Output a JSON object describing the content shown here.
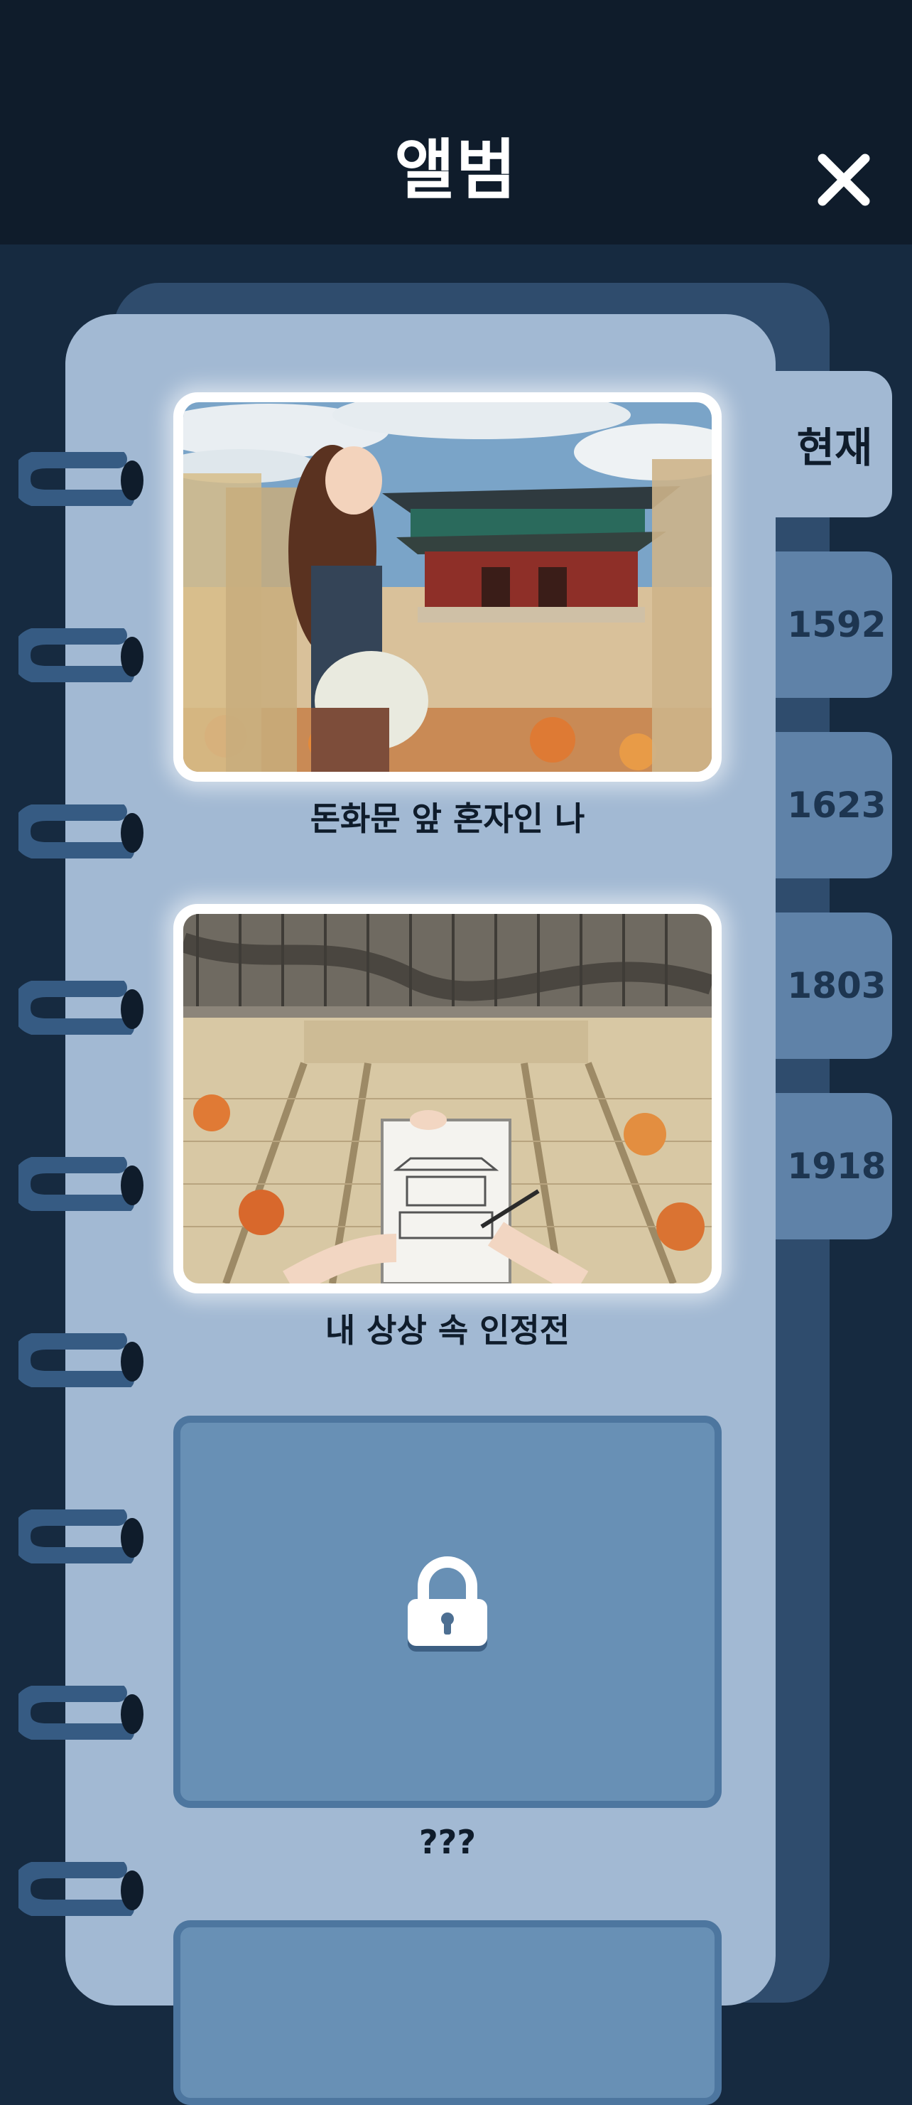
{
  "header": {
    "title": "앨범",
    "close_icon": "close-icon"
  },
  "tabs": [
    {
      "label": "현재",
      "active": true
    },
    {
      "label": "1592",
      "active": false
    },
    {
      "label": "1623",
      "active": false
    },
    {
      "label": "1803",
      "active": false
    },
    {
      "label": "1918",
      "active": false
    }
  ],
  "album": {
    "photos": [
      {
        "caption": "돈화문 앞 혼자인 나",
        "locked": false
      },
      {
        "caption": "내 상상 속 인정전",
        "locked": false
      },
      {
        "caption": "???",
        "locked": true,
        "icon": "lock-icon"
      }
    ]
  },
  "colors": {
    "header_bg": "#0f1c2b",
    "page_bg": "#a2b9d3",
    "tab_inactive": "#5f82a8",
    "locked_bg": "#6890b5"
  }
}
